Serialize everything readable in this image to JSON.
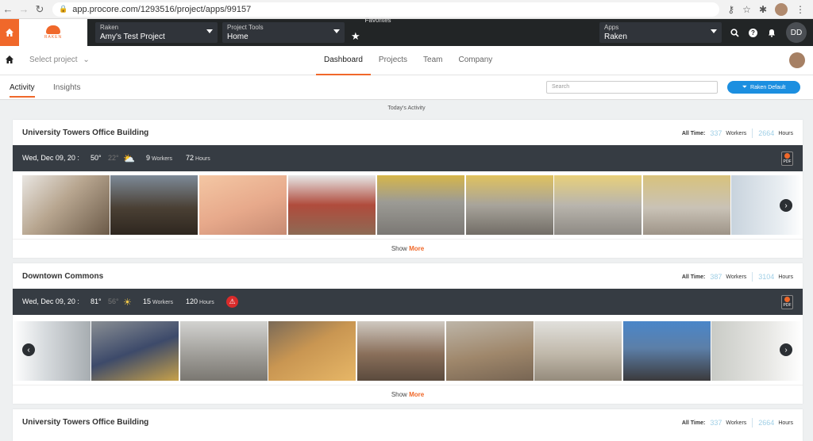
{
  "browser": {
    "url": "app.procore.com/1293516/project/apps/99157"
  },
  "header": {
    "logo_text": "RAKEN",
    "company": {
      "label": "Raken",
      "value": "Amy's Test Project"
    },
    "project_tools": {
      "label": "Project Tools",
      "value": "Home"
    },
    "favorites_label": "Favorites",
    "apps": {
      "label": "Apps",
      "value": "Raken"
    },
    "user_initials": "DD"
  },
  "nav": {
    "select_project": "Select project",
    "tabs": [
      "Dashboard",
      "Projects",
      "Team",
      "Company"
    ],
    "active": "Dashboard"
  },
  "subnav": {
    "tabs": [
      "Activity",
      "Insights"
    ],
    "active": "Activity",
    "search_placeholder": "Search",
    "filter_button": "Raken Default"
  },
  "today_label": "Today's Activity",
  "cards": [
    {
      "title": "University Towers Office Building",
      "all_time_label": "All Time:",
      "all_time_workers": "337",
      "workers_label": "Workers",
      "all_time_hours": "2664",
      "hours_label": "Hours",
      "date": "Wed, Dec 09, 20 :",
      "temp_high": "50°",
      "temp_low": "22°",
      "weather_icon": "cloudy-icon",
      "workers": "9",
      "workers_unit": "Workers",
      "hours": "72",
      "hours_unit": "Hours",
      "has_warning": false,
      "pdf_label": "PDF",
      "show": "Show",
      "more": "More"
    },
    {
      "title": "Downtown Commons",
      "all_time_label": "All Time:",
      "all_time_workers": "387",
      "workers_label": "Workers",
      "all_time_hours": "3104",
      "hours_label": "Hours",
      "date": "Wed, Dec 09, 20 :",
      "temp_high": "81°",
      "temp_low": "56°",
      "weather_icon": "sunny-icon",
      "workers": "15",
      "workers_unit": "Workers",
      "hours": "120",
      "hours_unit": "Hours",
      "has_warning": true,
      "pdf_label": "PDF",
      "show": "Show",
      "more": "More"
    },
    {
      "title": "University Towers Office Building",
      "all_time_label": "All Time:",
      "all_time_workers": "337",
      "workers_label": "Workers",
      "all_time_hours": "2664",
      "hours_label": "Hours"
    }
  ],
  "colors": {
    "accent": "#f0682a",
    "primary_blue": "#1c8fe0",
    "topbar": "#222526",
    "dayrow": "#363c43"
  }
}
